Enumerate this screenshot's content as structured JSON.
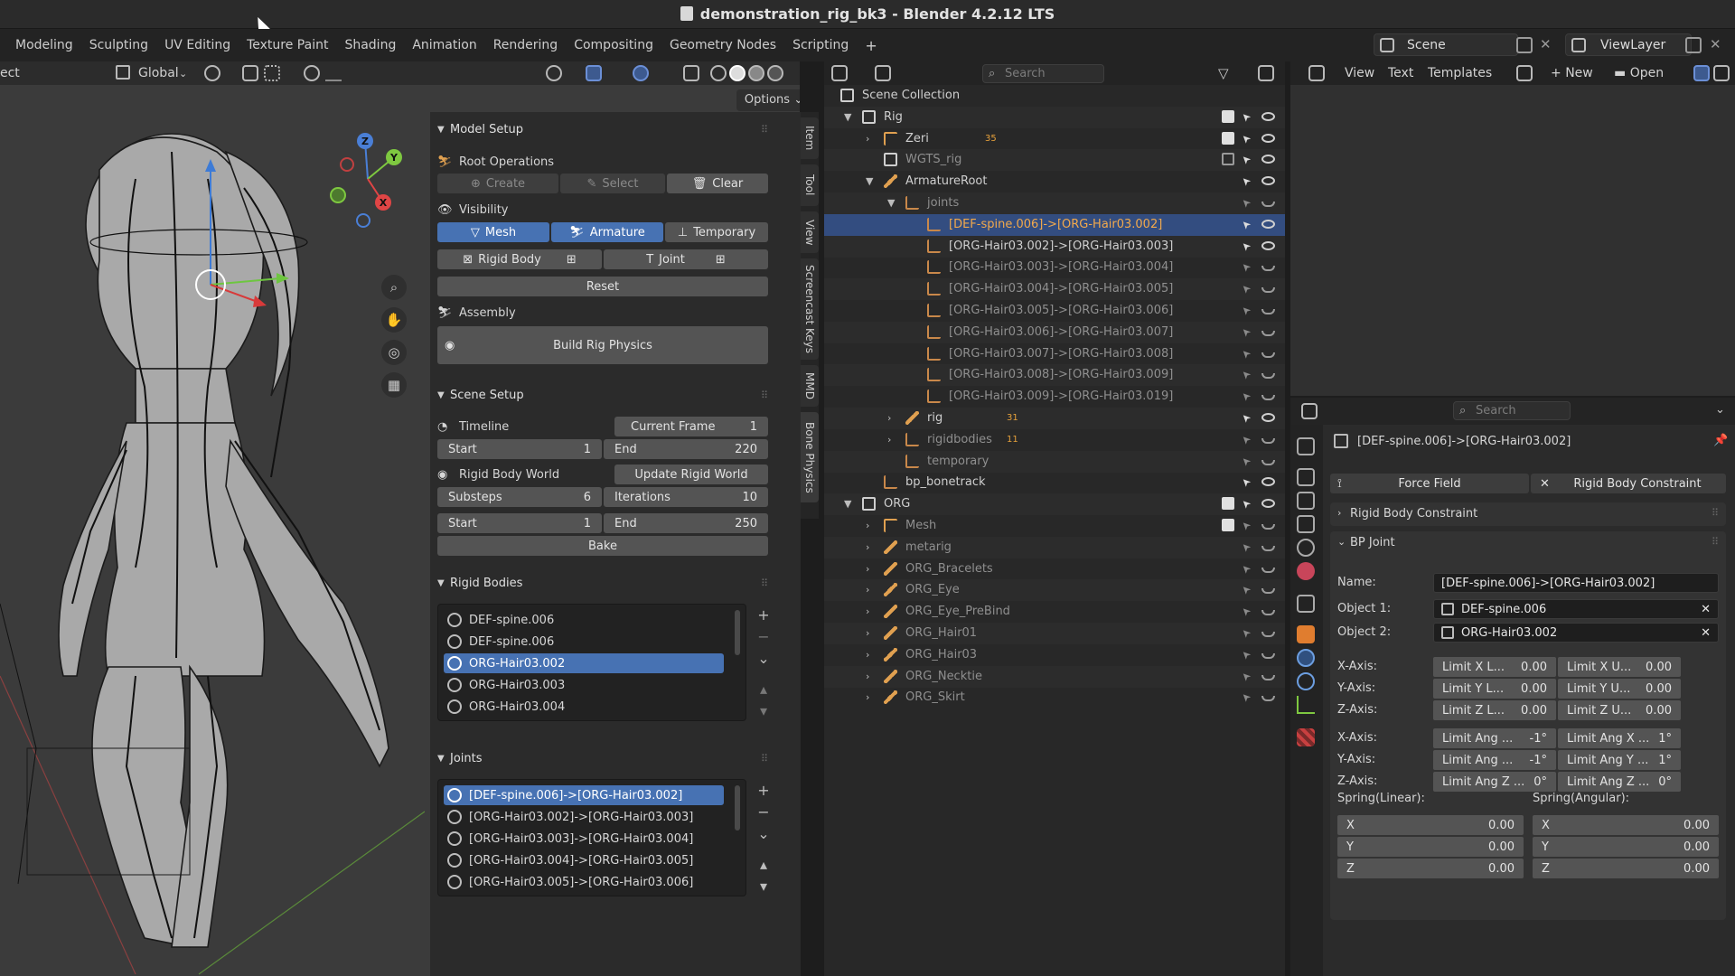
{
  "window": {
    "title": "demonstration_rig_bk3 - Blender 4.2.12 LTS"
  },
  "workspaces": [
    "Modeling",
    "Sculpting",
    "UV Editing",
    "Texture Paint",
    "Shading",
    "Animation",
    "Rendering",
    "Compositing",
    "Geometry Nodes",
    "Scripting",
    "+"
  ],
  "scene": {
    "label": "Scene"
  },
  "view_layer": {
    "label": "ViewLayer"
  },
  "viewport": {
    "mode_fragment": "ect",
    "orientation": "Global",
    "options_label": "Options",
    "gizmo_axes": {
      "x": "X",
      "y": "Y",
      "z": "Z"
    }
  },
  "npanel": {
    "model_setup": {
      "title": "Model Setup",
      "root_ops": "Root Operations",
      "create": "Create",
      "select": "Select",
      "clear": "Clear",
      "visibility": "Visibility",
      "mesh": "Mesh",
      "armature": "Armature",
      "temporary": "Temporary",
      "rigid_body": "Rigid Body",
      "joint": "Joint",
      "reset": "Reset",
      "assembly": "Assembly",
      "build": "Build Rig Physics"
    },
    "scene_setup": {
      "title": "Scene Setup",
      "timeline": "Timeline",
      "current_frame_label": "Current Frame",
      "current_frame": "1",
      "start_label": "Start",
      "start": "1",
      "end_label": "End",
      "end": "220",
      "rigid_world": "Rigid Body World",
      "update": "Update Rigid World",
      "substeps_label": "Substeps",
      "substeps": "6",
      "iterations_label": "Iterations",
      "iterations": "10",
      "start2": "1",
      "end2": "250",
      "bake": "Bake"
    },
    "rigid_bodies": {
      "title": "Rigid Bodies",
      "items": [
        "DEF-spine.006",
        "DEF-spine.006",
        "ORG-Hair03.002",
        "ORG-Hair03.003",
        "ORG-Hair03.004"
      ],
      "selected": 2
    },
    "joints": {
      "title": "Joints",
      "items": [
        "[DEF-spine.006]->[ORG-Hair03.002]",
        "[ORG-Hair03.002]->[ORG-Hair03.003]",
        "[ORG-Hair03.003]->[ORG-Hair03.004]",
        "[ORG-Hair03.004]->[ORG-Hair03.005]",
        "[ORG-Hair03.005]->[ORG-Hair03.006]"
      ],
      "selected": 0
    }
  },
  "sidebar_tabs": [
    "Item",
    "Tool",
    "View",
    "Screencast Keys",
    "MMD",
    "Bone Physics"
  ],
  "outliner": {
    "search_placeholder": "Search",
    "rows": [
      {
        "label": "Scene Collection",
        "depth": 0
      },
      {
        "label": "Rig",
        "depth": 1
      },
      {
        "label": "Zeri",
        "depth": 2,
        "badge": "35"
      },
      {
        "label": "WGTS_rig",
        "depth": 2
      },
      {
        "label": "ArmatureRoot",
        "depth": 2
      },
      {
        "label": "joints",
        "depth": 3
      },
      {
        "label": "[DEF-spine.006]->[ORG-Hair03.002]",
        "depth": 4
      },
      {
        "label": "[ORG-Hair03.002]->[ORG-Hair03.003]",
        "depth": 4
      },
      {
        "label": "[ORG-Hair03.003]->[ORG-Hair03.004]",
        "depth": 4
      },
      {
        "label": "[ORG-Hair03.004]->[ORG-Hair03.005]",
        "depth": 4
      },
      {
        "label": "[ORG-Hair03.005]->[ORG-Hair03.006]",
        "depth": 4
      },
      {
        "label": "[ORG-Hair03.006]->[ORG-Hair03.007]",
        "depth": 4
      },
      {
        "label": "[ORG-Hair03.007]->[ORG-Hair03.008]",
        "depth": 4
      },
      {
        "label": "[ORG-Hair03.008]->[ORG-Hair03.009]",
        "depth": 4
      },
      {
        "label": "[ORG-Hair03.009]->[ORG-Hair03.019]",
        "depth": 4
      },
      {
        "label": "rig",
        "depth": 3,
        "badge": "31"
      },
      {
        "label": "rigidbodies",
        "depth": 3,
        "badge": "11"
      },
      {
        "label": "temporary",
        "depth": 3
      },
      {
        "label": "bp_bonetrack",
        "depth": 2
      },
      {
        "label": "ORG",
        "depth": 1
      },
      {
        "label": "Mesh",
        "depth": 2
      },
      {
        "label": "metarig",
        "depth": 2
      },
      {
        "label": "ORG_Bracelets",
        "depth": 2
      },
      {
        "label": "ORG_Eye",
        "depth": 2
      },
      {
        "label": "ORG_Eye_PreBind",
        "depth": 2
      },
      {
        "label": "ORG_Hair01",
        "depth": 2
      },
      {
        "label": "ORG_Hair03",
        "depth": 2
      },
      {
        "label": "ORG_Necktie",
        "depth": 2
      },
      {
        "label": "ORG_Skirt",
        "depth": 2
      }
    ]
  },
  "text_editor": {
    "view": "View",
    "text": "Text",
    "templates": "Templates",
    "new": "New",
    "open": "Open"
  },
  "properties": {
    "search_placeholder": "Search",
    "object_name": "[DEF-spine.006]->[ORG-Hair03.002]",
    "force_field": "Force Field",
    "rigid_constraint_btn": "Rigid Body Constraint",
    "rbc_panel": "Rigid Body Constraint",
    "bp_panel": "BP Joint",
    "name_label": "Name:",
    "name": "[DEF-spine.006]->[ORG-Hair03.002]",
    "obj1_label": "Object 1:",
    "obj1": "DEF-spine.006",
    "obj2_label": "Object 2:",
    "obj2": "ORG-Hair03.002",
    "lin": [
      [
        "X-Axis:",
        "Limit X L...",
        "0.00",
        "Limit X U...",
        "0.00"
      ],
      [
        "Y-Axis:",
        "Limit Y L...",
        "0.00",
        "Limit Y U...",
        "0.00"
      ],
      [
        "Z-Axis:",
        "Limit Z L...",
        "0.00",
        "Limit Z U...",
        "0.00"
      ]
    ],
    "ang": [
      [
        "X-Axis:",
        "Limit Ang ...",
        "-1°",
        "Limit Ang X ...",
        "1°"
      ],
      [
        "Y-Axis:",
        "Limit Ang ...",
        "-1°",
        "Limit Ang Y ...",
        "1°"
      ],
      [
        "Z-Axis:",
        "Limit Ang Z ...",
        "0°",
        "Limit Ang Z ...",
        "0°"
      ]
    ],
    "spring_linear": "Spring(Linear):",
    "spring_angular": "Spring(Angular):",
    "springs": [
      [
        "X",
        "0.00",
        "X",
        "0.00"
      ],
      [
        "Y",
        "0.00",
        "Y",
        "0.00"
      ],
      [
        "Z",
        "0.00",
        "Z",
        "0.00"
      ]
    ]
  }
}
